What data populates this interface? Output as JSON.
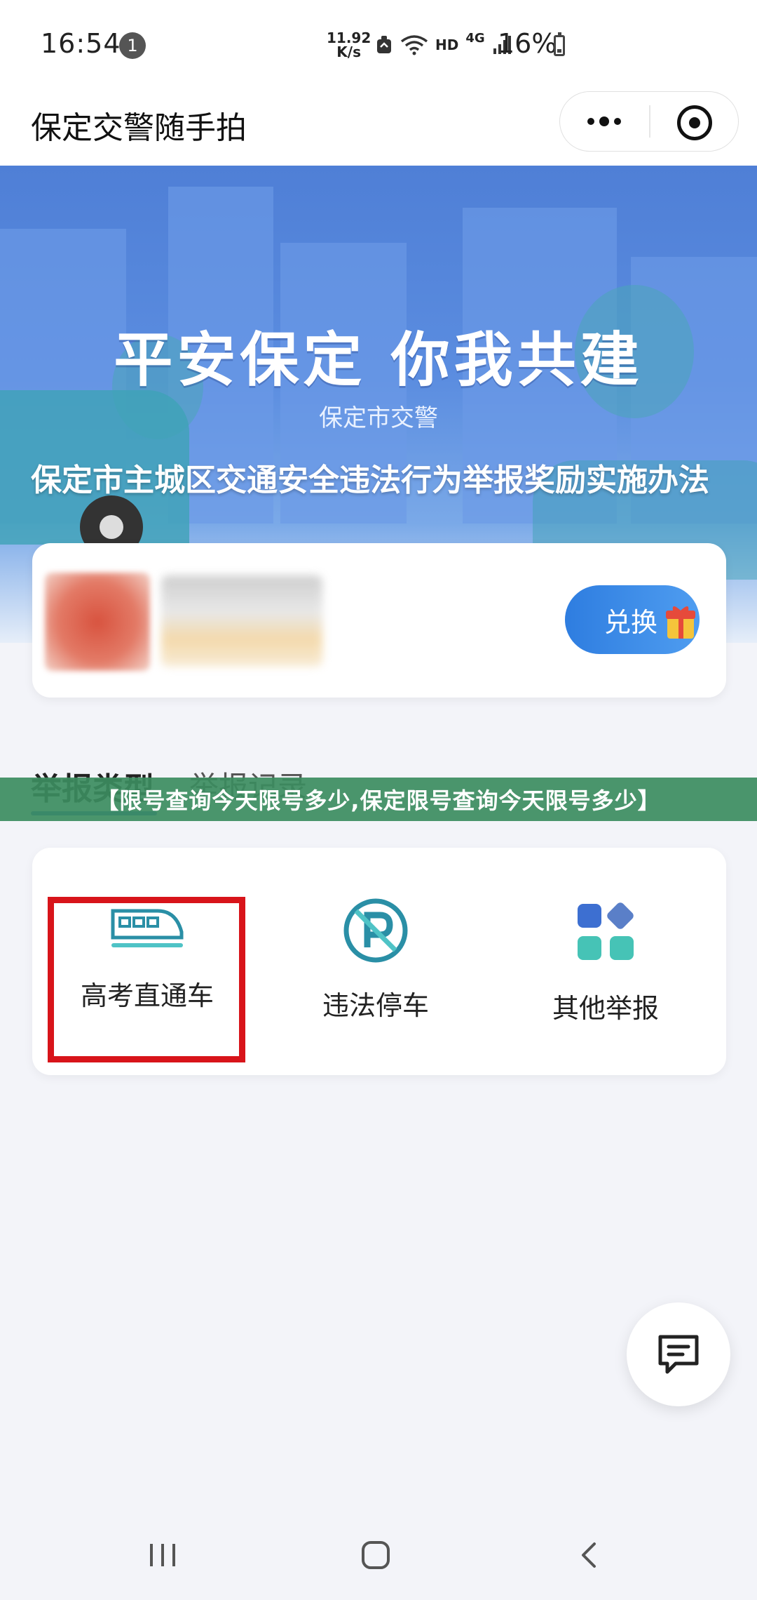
{
  "status_bar": {
    "time": "16:54",
    "notification_count": "1",
    "net_speed_value": "11.92",
    "net_speed_unit": "K/s",
    "network_label": "HD",
    "signal_label": "4G",
    "battery_percent": "16%"
  },
  "title_bar": {
    "title": "保定交警随手拍",
    "more_icon": "more-dots-icon",
    "close_icon": "target-close-icon"
  },
  "banner": {
    "slogan": "平安保定 你我共建",
    "subtitle": "保定市交警",
    "caption": "保定市主城区交通安全违法行为举报奖励实施办法"
  },
  "points_card": {
    "exchange_label": "兑换",
    "gift_icon": "gift-icon"
  },
  "tabs": [
    {
      "label": "举报类型",
      "active": true
    },
    {
      "label": "举报记录",
      "active": false
    }
  ],
  "watermark": "【限号查询今天限号多少,保定限号查询今天限号多少】",
  "report_types": [
    {
      "label": "高考直通车",
      "icon": "train-icon",
      "highlighted": true
    },
    {
      "label": "违法停车",
      "icon": "no-parking-icon",
      "highlighted": false
    },
    {
      "label": "其他举报",
      "icon": "apps-grid-icon",
      "highlighted": false
    }
  ],
  "float_button": {
    "icon": "chat-icon"
  },
  "colors": {
    "accent_blue": "#2e7de0",
    "teal": "#3fa2b6",
    "highlight_red": "#d8141a",
    "watermark_green": "#3c8c5f"
  },
  "nav_bar": {
    "recents_icon": "recents-icon",
    "home_icon": "home-icon",
    "back_icon": "back-icon"
  }
}
